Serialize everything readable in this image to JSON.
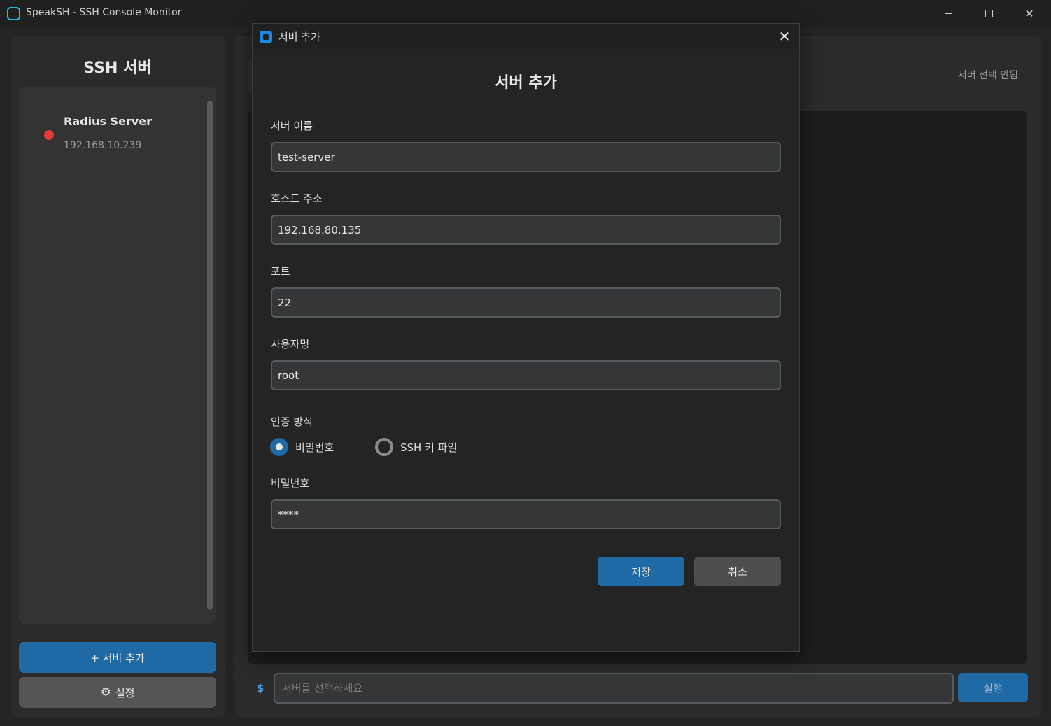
{
  "window": {
    "title": "SpeakSH - SSH Console Monitor",
    "minimize": "—",
    "maximize": "☐",
    "close": "✕"
  },
  "sidebar": {
    "title": "SSH 서버",
    "servers": [
      {
        "name": "Radius Server",
        "host": "192.168.10.239",
        "status_color": "#e53935"
      }
    ],
    "add_button": "+ 서버 추가",
    "settings_button": "설정",
    "settings_icon": "gear-icon"
  },
  "main": {
    "server_select_hint": "서버 선택 안됨",
    "prompt": "$",
    "command_placeholder": "서버를 선택하세요",
    "run_button": "실행"
  },
  "dialog": {
    "window_title": "서버 추가",
    "close": "✕",
    "heading": "서버 추가",
    "fields": {
      "name_label": "서버 이름",
      "name_value": "test-server",
      "host_label": "호스트 주소",
      "host_value": "192.168.80.135",
      "port_label": "포트",
      "port_value": "22",
      "user_label": "사용자명",
      "user_value": "root",
      "auth_label": "인증 방식",
      "auth_password": "비밀번호",
      "auth_key": "SSH 키 파일",
      "auth_selected": "비밀번호",
      "password_label": "비밀번호",
      "password_value": "****"
    },
    "save_button": "저장",
    "cancel_button": "취소"
  },
  "colors": {
    "accent": "#1f6aa5",
    "status_offline": "#e53935",
    "background": "#242424"
  }
}
